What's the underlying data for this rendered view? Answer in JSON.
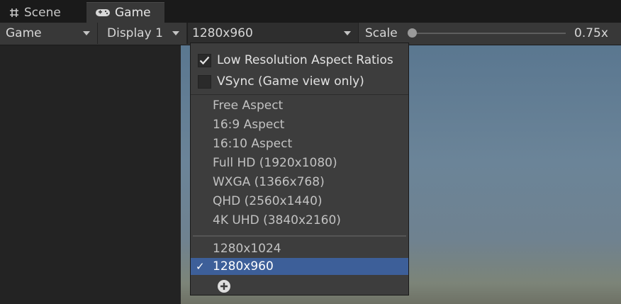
{
  "tabs": [
    {
      "label": "Scene",
      "icon": "grid-icon"
    },
    {
      "label": "Game",
      "icon": "gamepad-icon"
    }
  ],
  "toolbar": {
    "game_dropdown": "Game",
    "display_dropdown": "Display 1",
    "resolution_dropdown": "1280x960",
    "scale_label": "Scale",
    "scale_value": "0.75x"
  },
  "menu": {
    "low_res": {
      "label": "Low Resolution Aspect Ratios",
      "checked": true
    },
    "vsync": {
      "label": "VSync (Game view only)",
      "checked": false
    },
    "aspects": [
      "Free Aspect",
      "16:9 Aspect",
      "16:10 Aspect",
      "Full HD (1920x1080)",
      "WXGA (1366x768)",
      "QHD (2560x1440)",
      "4K UHD (3840x2160)"
    ],
    "custom": [
      "1280x1024",
      "1280x960"
    ],
    "selected_check": "✓",
    "add_icon": "plus-circle-icon"
  },
  "colors": {
    "selection": "#3d5f99",
    "menu_bg": "#3d3d3d",
    "toolbar_bg": "#383838"
  }
}
